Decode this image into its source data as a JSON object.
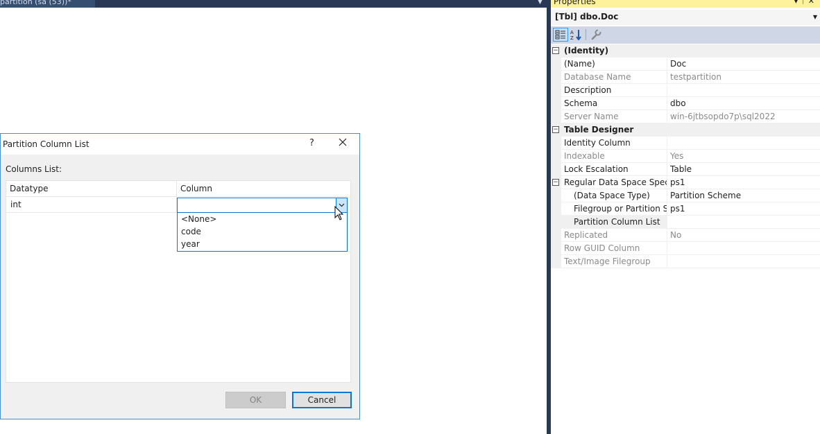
{
  "document_tab": {
    "title": "partition (sa (53))*"
  },
  "properties": {
    "title": "Properties",
    "object": "[Tbl] dbo.Doc",
    "rows": [
      {
        "type": "category",
        "name": "(Identity)"
      },
      {
        "type": "prop",
        "name": "(Name)",
        "value": "Doc"
      },
      {
        "type": "prop",
        "name": "Database Name",
        "value": "testpartition",
        "readonly": true
      },
      {
        "type": "prop",
        "name": "Description",
        "value": ""
      },
      {
        "type": "prop",
        "name": "Schema",
        "value": "dbo"
      },
      {
        "type": "prop",
        "name": "Server Name",
        "value": "win-6jtbsopdo7p\\sql2022",
        "readonly": true
      },
      {
        "type": "category",
        "name": "Table Designer"
      },
      {
        "type": "prop",
        "name": "Identity Column",
        "value": ""
      },
      {
        "type": "prop",
        "name": "Indexable",
        "value": "Yes",
        "readonly": true
      },
      {
        "type": "prop",
        "name": "Lock Escalation",
        "value": "Table"
      },
      {
        "type": "expandable",
        "name": "Regular Data Space Specificat",
        "value": "ps1"
      },
      {
        "type": "sub",
        "name": "(Data Space Type)",
        "value": "Partition Scheme"
      },
      {
        "type": "sub",
        "name": "Filegroup or Partition Sche",
        "value": "ps1"
      },
      {
        "type": "sub",
        "name": "Partition Column List",
        "value": "",
        "selected": true
      },
      {
        "type": "prop",
        "name": "Replicated",
        "value": "No",
        "readonly": true
      },
      {
        "type": "prop",
        "name": "Row GUID Column",
        "value": "",
        "readonly": true
      },
      {
        "type": "prop",
        "name": "Text/Image Filegroup",
        "value": "",
        "readonly": true
      }
    ]
  },
  "dialog": {
    "title": "Partition Column List",
    "help": "?",
    "close": "✕",
    "columns_label": "Columns List:",
    "headers": {
      "datatype": "Datatype",
      "column": "Column"
    },
    "row": {
      "datatype": "int",
      "column": ""
    },
    "options": [
      "<None>",
      "code",
      "year"
    ],
    "ok_label": "OK",
    "cancel_label": "Cancel"
  },
  "colors": {
    "accent": "#0078d7",
    "props_title_bg": "#fff29d",
    "tabstrip_bg": "#293955"
  }
}
